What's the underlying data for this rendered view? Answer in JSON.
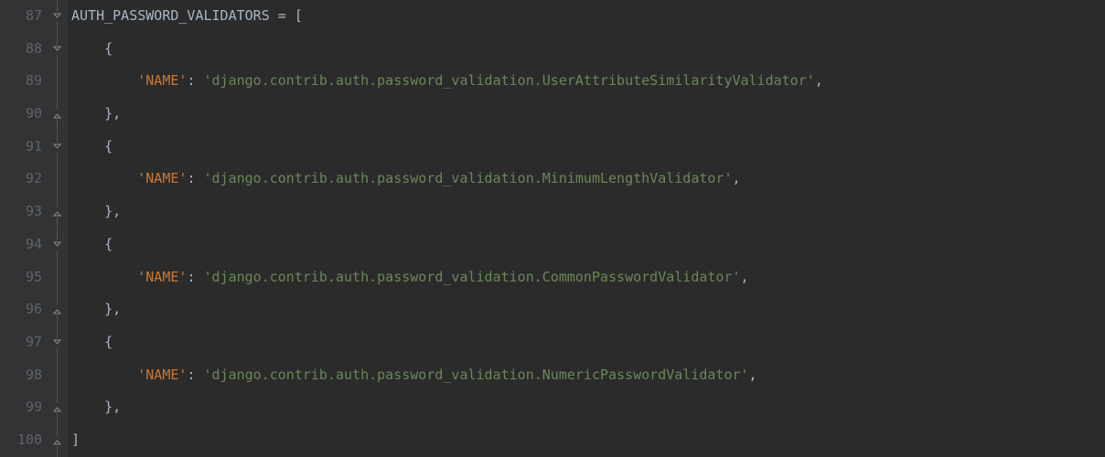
{
  "lineStart": 87,
  "varName": "AUTH_PASSWORD_VALIDATORS",
  "assignOp": " = ",
  "openBracket": "[",
  "closeBracket": "]",
  "openBrace": "{",
  "closeBrace": "},",
  "keyLabel": "'NAME'",
  "colon": ": ",
  "validators": [
    "'django.contrib.auth.password_validation.UserAttributeSimilarityValidator'",
    "'django.contrib.auth.password_validation.MinimumLengthValidator'",
    "'django.contrib.auth.password_validation.CommonPasswordValidator'",
    "'django.contrib.auth.password_validation.NumericPasswordValidator'"
  ],
  "comma": ",",
  "lineNumbers": [
    "87",
    "88",
    "89",
    "90",
    "91",
    "92",
    "93",
    "94",
    "95",
    "96",
    "97",
    "98",
    "99",
    "100"
  ],
  "foldMarkers": [
    {
      "row": 0,
      "type": "open"
    },
    {
      "row": 1,
      "type": "open"
    },
    {
      "row": 3,
      "type": "close"
    },
    {
      "row": 4,
      "type": "open"
    },
    {
      "row": 6,
      "type": "close"
    },
    {
      "row": 7,
      "type": "open"
    },
    {
      "row": 9,
      "type": "close"
    },
    {
      "row": 10,
      "type": "open"
    },
    {
      "row": 12,
      "type": "close"
    },
    {
      "row": 13,
      "type": "close"
    }
  ]
}
